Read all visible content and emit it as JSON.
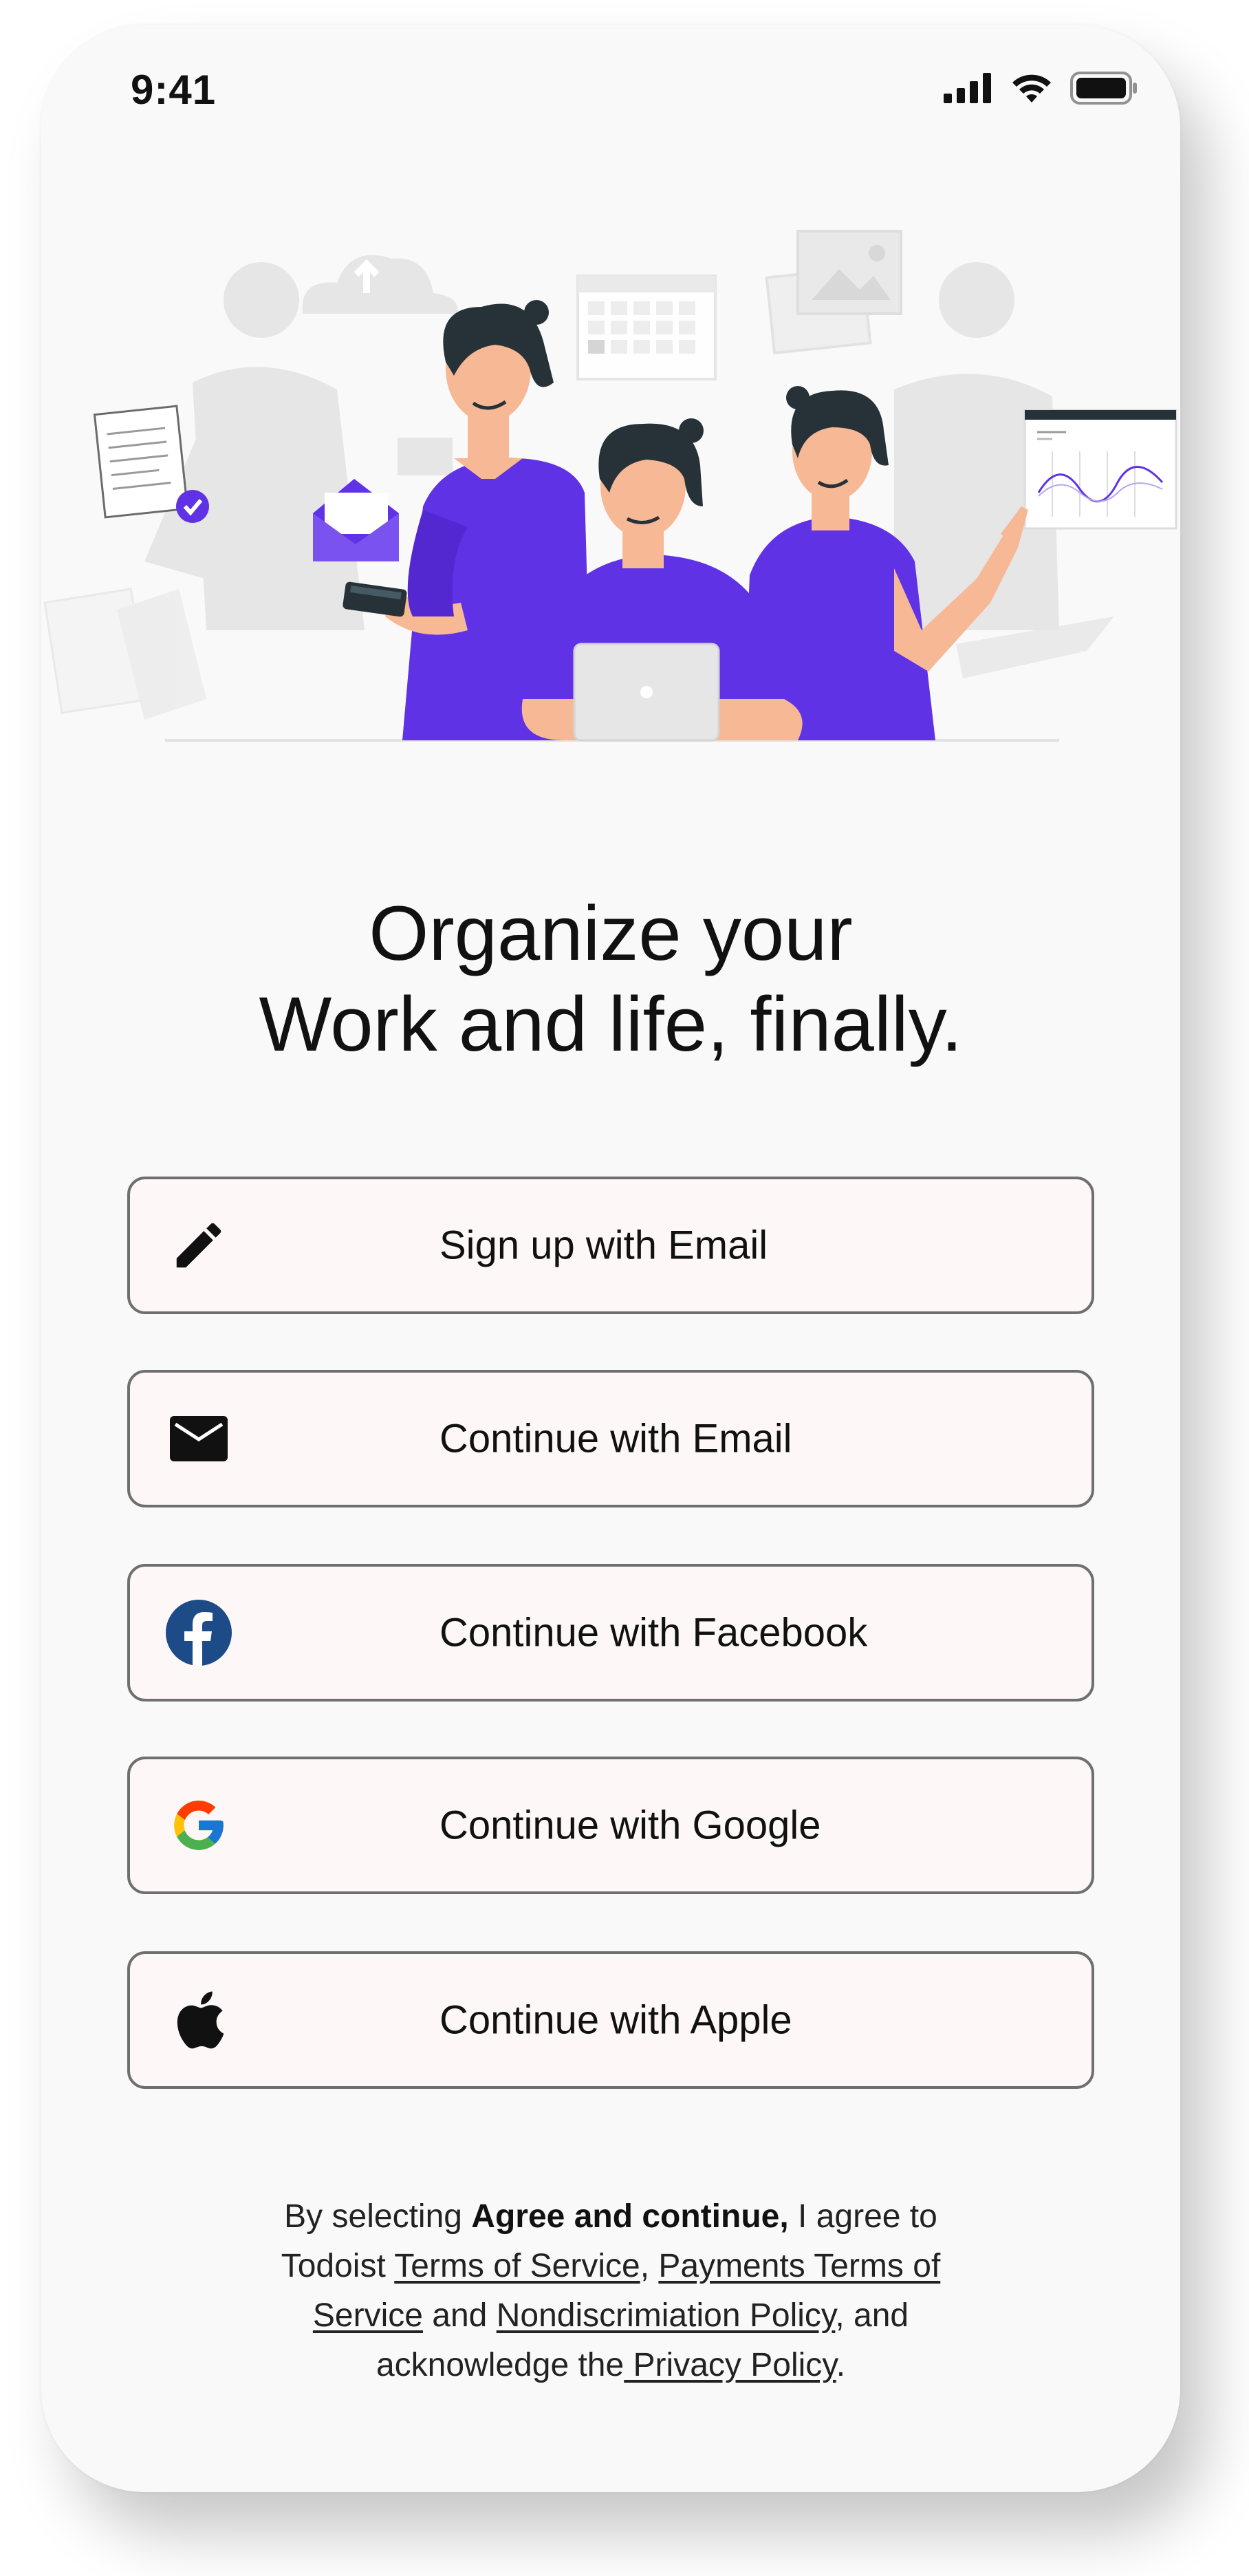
{
  "status_bar": {
    "time": "9:41",
    "icons": [
      "signal-icon",
      "wifi-icon",
      "battery-icon"
    ]
  },
  "hero": {
    "illustration": "team-working-illustration",
    "colors": {
      "accent": "#6032e5",
      "skin": "#f7b896",
      "hair": "#263238",
      "faded": "#e6e6e6"
    }
  },
  "headline": {
    "line1": "Organize your",
    "line2": "Work and life, finally."
  },
  "buttons": [
    {
      "label": "Sign up with Email",
      "icon": "pencil-icon"
    },
    {
      "label": "Continue with Email",
      "icon": "envelope-icon"
    },
    {
      "label": "Continue with Facebook",
      "icon": "facebook-icon"
    },
    {
      "label": "Continue with Google",
      "icon": "google-icon"
    },
    {
      "label": "Continue with Apple",
      "icon": "apple-icon"
    }
  ],
  "legal": {
    "t1": "By selecting ",
    "bold": "Agree and continue,",
    "t2": " I agree to Todoist ",
    "link_terms": "Terms of Service",
    "t3": ", ",
    "link_payments": "Payments Terms of Service",
    "t4": " and ",
    "link_nondiscrimination": "Nondiscrimiation Policy",
    "t5": ", and acknowledge the",
    "link_privacy": " Privacy Policy",
    "t6": "."
  },
  "colors": {
    "background": "#f9f9f9",
    "button_bg": "#fdf8f7",
    "button_border": "#6f6f6f",
    "facebook": "#1c4b87"
  }
}
